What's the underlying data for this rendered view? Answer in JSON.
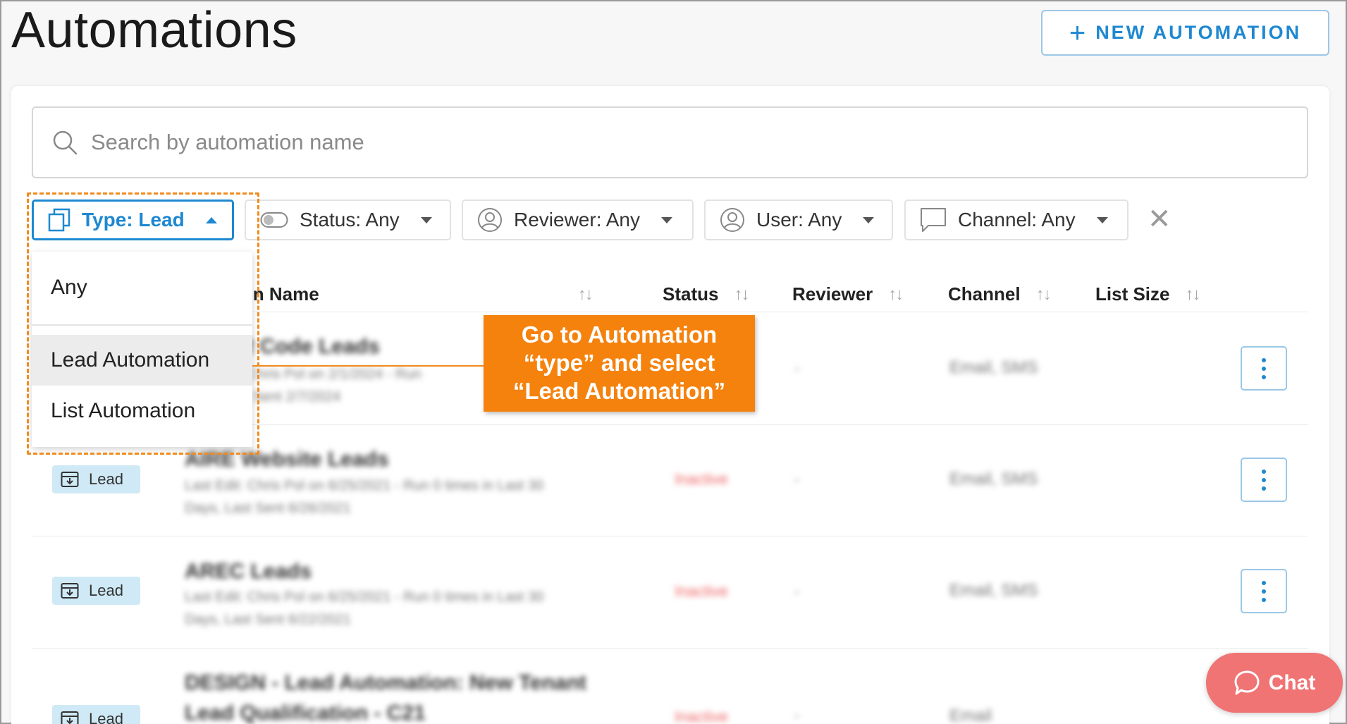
{
  "header": {
    "title": "Automations",
    "new_button_label": "NEW AUTOMATION"
  },
  "search": {
    "placeholder": "Search by automation name"
  },
  "filters": {
    "type": "Type: Lead",
    "status": "Status: Any",
    "reviewer": "Reviewer: Any",
    "user": "User: Any",
    "channel": "Channel: Any"
  },
  "table": {
    "columns": [
      "tion Name",
      "Status",
      "Reviewer",
      "Channel",
      "List Size"
    ],
    "rows": [
      {
        "name": "ITA QR Code Leads",
        "sub": [
          "Last Edit: Chris Pol on 2/1/2024 - Run",
          "days, Last Sent 2/7/2024"
        ],
        "status": "",
        "reviewer": "-",
        "channel": "Email, SMS"
      },
      {
        "type": "Lead",
        "name": "AIRE Website Leads",
        "sub": [
          "Last Edit: Chris Pol on 6/25/2021 - Run 0 times in Last 30",
          "Days, Last Sent 6/26/2021"
        ],
        "status": "Inactive",
        "reviewer": "-",
        "channel": "Email, SMS"
      },
      {
        "type": "Lead",
        "name": "AREC Leads",
        "sub": [
          "Last Edit: Chris Pol on 6/25/2021 - Run 0 times in Last 30",
          "Days, Last Sent 6/22/2021"
        ],
        "status": "Inactive",
        "reviewer": "-",
        "channel": "Email, SMS"
      },
      {
        "type": "Lead",
        "name": "DESIGN - Lead Automation: New Tenant",
        "name2": "Lead Qualification - C21",
        "status": "Inactive",
        "reviewer": "-",
        "channel": "Email"
      }
    ]
  },
  "dropdown": {
    "options": [
      "Any",
      "Lead Automation",
      "List Automation"
    ]
  },
  "callout": {
    "lines": [
      "Go to Automation",
      "“type” and select",
      "“Lead Automation”"
    ]
  },
  "chat": {
    "label": "Chat"
  }
}
